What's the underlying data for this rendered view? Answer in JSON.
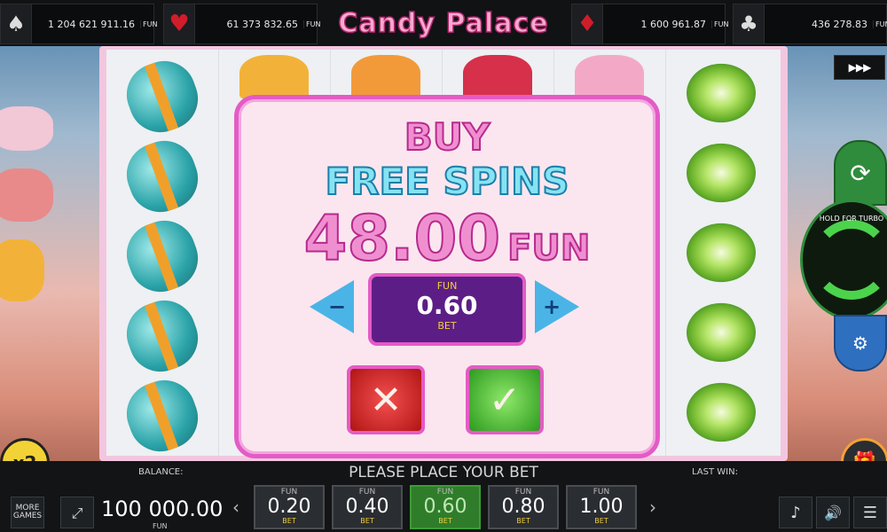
{
  "header": {
    "title": "Candy Palace",
    "jackpots": [
      {
        "suit": "spade-icon",
        "value": "1 204 621 911.16",
        "currency": "FUN"
      },
      {
        "suit": "heart-icon",
        "value": "61 373 832.65",
        "currency": "FUN"
      },
      {
        "suit": "diamond-icon",
        "value": "1 600 961.87",
        "currency": "FUN"
      },
      {
        "suit": "club-icon",
        "value": "436 278.83",
        "currency": "FUN"
      }
    ]
  },
  "dialog": {
    "line1": "BUY",
    "line2": "FREE SPINS",
    "price": "48.00",
    "price_currency": "FUN",
    "bet_currency": "FUN",
    "bet_value": "0.60",
    "bet_label": "BET",
    "minus": "−",
    "plus": "+",
    "cancel_glyph": "✕",
    "confirm_glyph": "✓"
  },
  "side": {
    "turbo_label": "▶▶▶",
    "hold_for_turbo": "HOLD FOR TURBO"
  },
  "footer": {
    "balance_label": "BALANCE:",
    "message": "PLEASE PLACE YOUR BET",
    "last_win_label": "LAST WIN:",
    "more_games": "MORE GAMES",
    "balance_value": "100 000.00",
    "balance_currency": "FUN",
    "x2": "x2",
    "bets": [
      {
        "currency": "FUN",
        "amount": "0.20",
        "label": "BET",
        "selected": false
      },
      {
        "currency": "FUN",
        "amount": "0.40",
        "label": "BET",
        "selected": false
      },
      {
        "currency": "FUN",
        "amount": "0.60",
        "label": "BET",
        "selected": true
      },
      {
        "currency": "FUN",
        "amount": "0.80",
        "label": "BET",
        "selected": false
      },
      {
        "currency": "FUN",
        "amount": "1.00",
        "label": "BET",
        "selected": false
      }
    ]
  }
}
